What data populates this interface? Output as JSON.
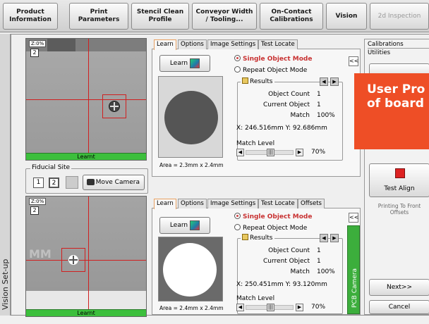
{
  "nav": {
    "buttons": [
      "Product Information",
      "Print Parameters",
      "Stencil Clean Profile",
      "Conveyor Width / Tooling...",
      "On-Contact Calibrations",
      "Vision",
      "2d Inspection"
    ]
  },
  "side_label": "Vision Set-up",
  "cam_top": {
    "zoom": "Z:0%",
    "number": "2",
    "status": "Learnt"
  },
  "cam_bottom": {
    "zoom": "Z:0%",
    "number": "2",
    "status": "Learnt",
    "overlay_text": "MM"
  },
  "fiducial": {
    "title": "Fiducial Site",
    "site1": "1",
    "site2": "2",
    "move_camera": "Move Camera"
  },
  "panel_top": {
    "tabs": [
      "Learn",
      "Options",
      "Image Settings",
      "Test Locate"
    ],
    "learn": "Learn",
    "mode_single": "Single Object Mode",
    "mode_repeat": "Repeat Object Mode",
    "results": "Results",
    "object_count_label": "Object Count",
    "object_count": "1",
    "current_object_label": "Current Object",
    "current_object": "1",
    "match_label": "Match",
    "match": "100%",
    "xy": "X: 246.516mm Y: 92.686mm",
    "match_level": "Match Level",
    "level": "70%",
    "area": "Area = 2.3mm x 2.4mm",
    "collapse": "<<"
  },
  "panel_bottom": {
    "tabs": [
      "Learn",
      "Options",
      "Image Settings",
      "Test Locate",
      "Offsets"
    ],
    "learn": "Learn",
    "mode_single": "Single Object Mode",
    "mode_repeat": "Repeat Object Mode",
    "results": "Results",
    "object_count_label": "Object Count",
    "object_count": "1",
    "current_object_label": "Current Object",
    "current_object": "1",
    "match_label": "Match",
    "match": "100%",
    "xy": "X: 250.451mm Y: 93.120mm",
    "match_level": "Match Level",
    "level": "70%",
    "area": "Area = 2.4mm x 2.4mm",
    "collapse": "<<",
    "vertical": "PCB Camera"
  },
  "right": {
    "calibrations": "Calibrations",
    "utilities": "Utilities",
    "test_align": "Test Align",
    "printing_note": "Printing To Front Offsets",
    "next": "Next>>",
    "cancel": "Cancel"
  },
  "overlay": {
    "line1": "User Pro",
    "line2": "of board"
  },
  "colors": {
    "accent": "#ee4e26",
    "status_green": "#3cbf3c",
    "selected_red": "#c83232"
  }
}
